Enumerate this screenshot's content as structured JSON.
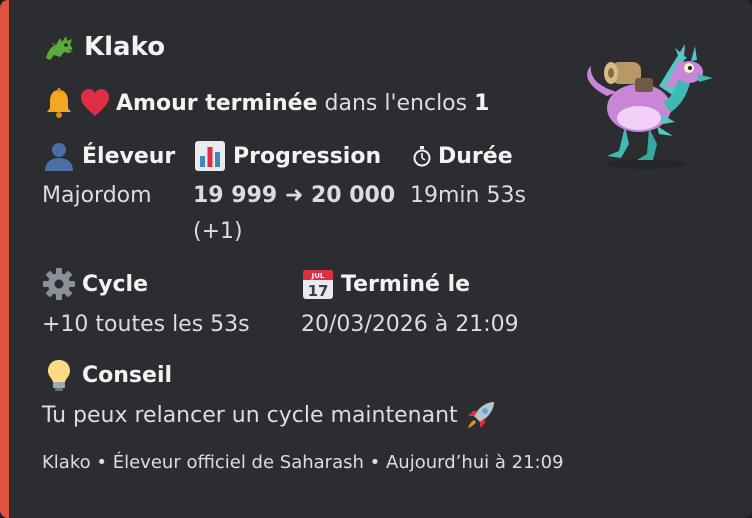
{
  "embed": {
    "accent_color": "#e0533f",
    "title": "Klako",
    "title_icon": "dragon-icon",
    "status": {
      "icons": [
        "bell-icon",
        "heart-icon"
      ],
      "bold": "Amour terminée",
      "middle": " dans l'enclos ",
      "pen_number": "1"
    },
    "fields": {
      "breeder": {
        "icon": "person-icon",
        "name": "Éleveur",
        "value": "Majordom"
      },
      "progress": {
        "icon": "bar-chart-icon",
        "name": "Progression",
        "value": "19 999 ➜ 20 000",
        "delta": "(+1)"
      },
      "duration": {
        "icon": "stopwatch-icon",
        "name": "Durée",
        "value": "19min 53s"
      },
      "cycle": {
        "icon": "gear-icon",
        "name": "Cycle",
        "value": "+10 toutes les 53s"
      },
      "finished": {
        "icon": "calendar-icon",
        "name": "Terminé le",
        "value": "20/03/2026 à 21:09",
        "calendar_month": "JUL",
        "calendar_day": "17"
      },
      "tip": {
        "icon": "lightbulb-icon",
        "name": "Conseil",
        "value": "Tu peux relancer un cycle maintenant",
        "value_icon": "rocket-icon"
      }
    },
    "footer": {
      "bot_name": "Klako",
      "subtitle": "Éleveur officiel de Saharash",
      "timestamp": "Aujourd’hui à 21:09",
      "separator": "•"
    },
    "thumbnail": "dragon-creature-image"
  }
}
